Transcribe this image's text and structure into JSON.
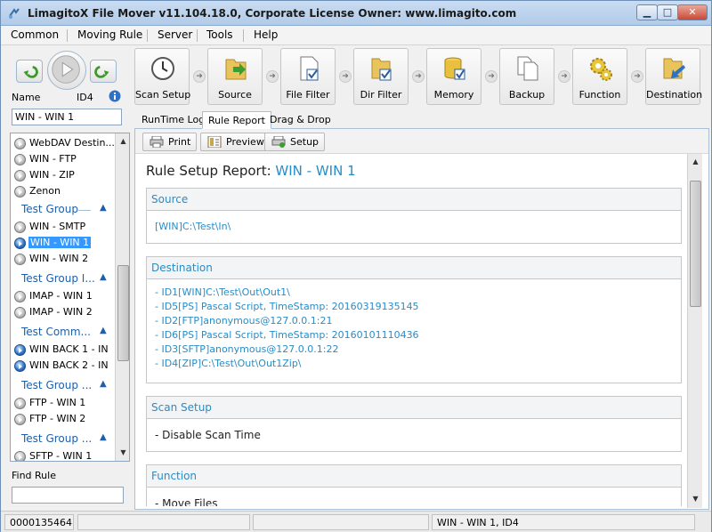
{
  "window": {
    "title": "LimagitoX File Mover v11.104.18.0, Corporate License Owner: www.limagito.com",
    "controls": {
      "minimize": "▁",
      "maximize": "□",
      "close": "✕"
    }
  },
  "menu": {
    "items": [
      {
        "label": "Common"
      },
      {
        "label": "Moving Rule"
      },
      {
        "label": "Server"
      },
      {
        "label": "Tools"
      },
      {
        "label": "Help"
      }
    ]
  },
  "left": {
    "name_label": "Name",
    "id_label": "ID4",
    "name_value": "WIN - WIN 1",
    "find_label": "Find Rule",
    "find_value": "",
    "rules": [
      {
        "type": "rule",
        "label": "WebDAV Destin...",
        "icon": "grey"
      },
      {
        "type": "rule",
        "label": "WIN - FTP",
        "icon": "grey"
      },
      {
        "type": "rule",
        "label": "WIN - ZIP",
        "icon": "grey"
      },
      {
        "type": "rule",
        "label": "Zenon",
        "icon": "grey"
      },
      {
        "type": "group",
        "label": "Test Group"
      },
      {
        "type": "rule",
        "label": "WIN - SMTP",
        "icon": "grey"
      },
      {
        "type": "rule",
        "label": "WIN - WIN 1",
        "icon": "blue-light",
        "selected": true
      },
      {
        "type": "rule",
        "label": "WIN - WIN 2",
        "icon": "grey"
      },
      {
        "type": "group",
        "label": "Test Group I..."
      },
      {
        "type": "rule",
        "label": "IMAP - WIN 1",
        "icon": "grey"
      },
      {
        "type": "rule",
        "label": "IMAP - WIN 2",
        "icon": "grey"
      },
      {
        "type": "group",
        "label": "Test Comm..."
      },
      {
        "type": "rule",
        "label": "WIN BACK 1 - IN",
        "icon": "blue"
      },
      {
        "type": "rule",
        "label": "WIN BACK 2 - IN",
        "icon": "blue"
      },
      {
        "type": "group",
        "label": "Test Group ..."
      },
      {
        "type": "rule",
        "label": "FTP - WIN 1",
        "icon": "grey"
      },
      {
        "type": "rule",
        "label": "FTP - WIN 2",
        "icon": "grey"
      },
      {
        "type": "group",
        "label": "Test Group ..."
      },
      {
        "type": "rule",
        "label": "SFTP - WIN 1",
        "icon": "grey"
      }
    ]
  },
  "toolbar": {
    "buttons": [
      {
        "label": "Scan Setup",
        "icon": "clock-icon"
      },
      {
        "label": "Source",
        "icon": "folder-arrow-icon"
      },
      {
        "label": "File Filter",
        "icon": "document-check-icon"
      },
      {
        "label": "Dir Filter",
        "icon": "folder-check-icon"
      },
      {
        "label": "Memory",
        "icon": "database-icon"
      },
      {
        "label": "Backup",
        "icon": "copy-icon"
      },
      {
        "label": "Function",
        "icon": "gear-icon"
      },
      {
        "label": "Destination",
        "icon": "folder-out-icon"
      }
    ]
  },
  "tabs": [
    {
      "label": "RunTime Log"
    },
    {
      "label": "Rule Report",
      "active": true
    },
    {
      "label": "Drag & Drop"
    }
  ],
  "report_toolbar": {
    "print": "Print",
    "preview": "Preview",
    "setup": "Setup"
  },
  "report": {
    "title_prefix": "Rule Setup Report:",
    "title_name": "WIN - WIN 1",
    "sections": [
      {
        "title": "Source",
        "lines": [
          "[WIN]C:\\Test\\In\\"
        ],
        "color": "blue"
      },
      {
        "title": "Destination",
        "lines": [
          "- ID1[WIN]C:\\Test\\Out\\Out1\\",
          "- ID5[PS] Pascal Script, TimeStamp: 20160319135145",
          "- ID2[FTP]anonymous@127.0.0.1:21",
          "- ID6[PS] Pascal Script, TimeStamp: 20160101110436",
          "- ID3[SFTP]anonymous@127.0.0.1:22",
          "- ID4[ZIP]C:\\Test\\Out\\Out1Zip\\"
        ],
        "color": "blue"
      },
      {
        "title": "Scan Setup",
        "lines": [
          "- Disable Scan Time"
        ],
        "color": "black"
      },
      {
        "title": "Function",
        "lines": [
          "- Move Files"
        ],
        "color": "black"
      }
    ]
  },
  "status": {
    "count": "0000135464",
    "panel2": "",
    "panel3": "",
    "rule": "WIN - WIN 1, ID4"
  }
}
